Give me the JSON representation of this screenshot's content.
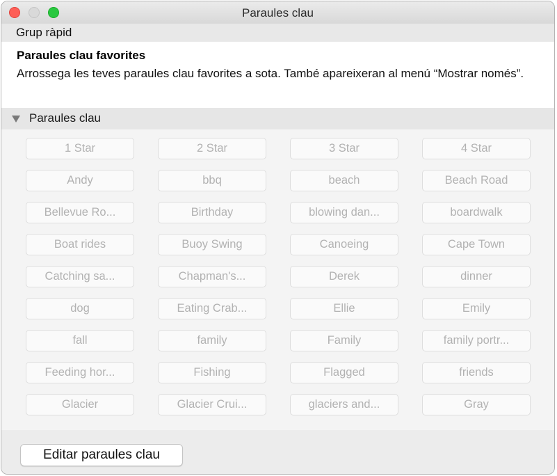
{
  "window": {
    "title": "Paraules clau"
  },
  "group_bar": {
    "label": "Grup ràpid"
  },
  "favorites": {
    "title": "Paraules clau favorites",
    "description": "Arrossega les teves paraules clau favorites a sota. També apareixeran al menú “Mostrar només”."
  },
  "keywords_section": {
    "label": "Paraules clau"
  },
  "keywords": [
    "1 Star",
    "2 Star",
    "3 Star",
    "4 Star",
    "Andy",
    "bbq",
    "beach",
    "Beach Road",
    "Bellevue Ro...",
    "Birthday",
    "blowing dan...",
    "boardwalk",
    "Boat rides",
    "Buoy Swing",
    "Canoeing",
    "Cape Town",
    "Catching sa...",
    "Chapman's...",
    "Derek",
    "dinner",
    "dog",
    "Eating Crab...",
    "Ellie",
    "Emily",
    "fall",
    "family",
    "Family",
    "family portr...",
    "Feeding hor...",
    "Fishing",
    "Flagged",
    "friends",
    "Glacier",
    "Glacier Crui...",
    "glaciers and...",
    "Gray"
  ],
  "footer": {
    "edit_label": "Editar paraules clau"
  },
  "colors": {
    "close": "#fd5f57",
    "minimize_disabled": "#d9d9d9",
    "zoom": "#29c840",
    "keyword_text_disabled": "#b2b2b2"
  }
}
